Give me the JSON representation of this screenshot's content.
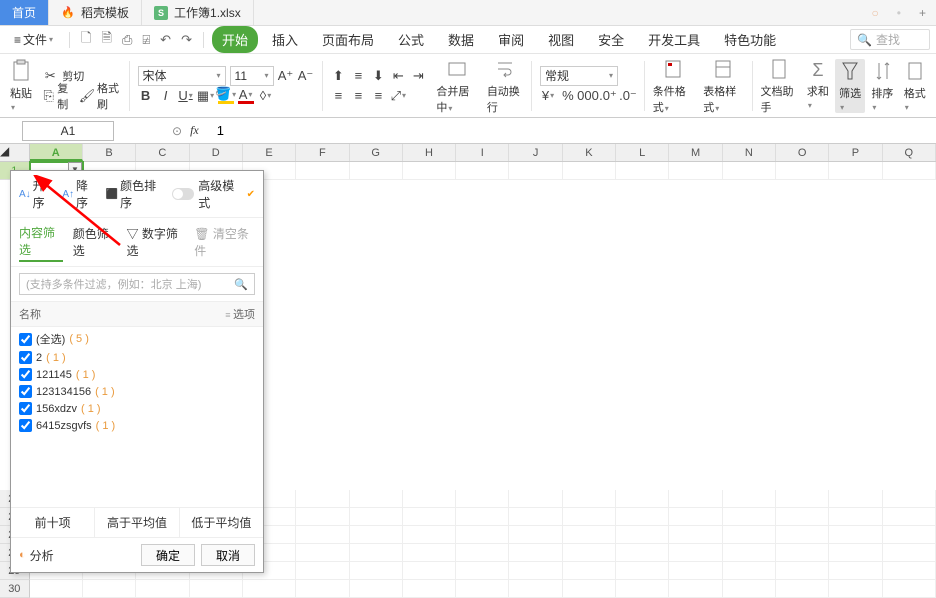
{
  "tabs": {
    "home": "首页",
    "template": "稻壳模板",
    "workbook": "工作簿1.xlsx"
  },
  "menu": {
    "file": "文件",
    "start": "开始",
    "insert": "插入",
    "page_layout": "页面布局",
    "formula": "公式",
    "data": "数据",
    "review": "审阅",
    "view": "视图",
    "security": "安全",
    "dev": "开发工具",
    "features": "特色功能",
    "search": "查找"
  },
  "ribbon": {
    "paste": "粘贴",
    "cut": "剪切",
    "copy": "复制",
    "format_painter": "格式刷",
    "font_name": "宋体",
    "font_size": "11",
    "merge": "合并居中",
    "wrap": "自动换行",
    "format": "常规",
    "cond_format": "条件格式",
    "table_style": "表格样式",
    "doc_helper": "文档助手",
    "sum": "求和",
    "filter": "筛选",
    "sort": "排序",
    "style": "格式"
  },
  "name_box": "A1",
  "formula_value": "1",
  "columns": [
    "A",
    "B",
    "C",
    "D",
    "E",
    "F",
    "G",
    "H",
    "I",
    "J",
    "K",
    "L",
    "M",
    "N",
    "O",
    "P",
    "Q"
  ],
  "rows_visible": [
    "1"
  ],
  "rows_visible_bottom": [
    "25",
    "26",
    "27",
    "28",
    "29",
    "30"
  ],
  "filter_panel": {
    "asc": "升序",
    "desc": "降序",
    "color_sort": "颜色排序",
    "advanced": "高级模式",
    "content_filter": "内容筛选",
    "color_filter": "颜色筛选",
    "number_filter": "数字筛选",
    "clear_filter": "清空条件",
    "search_placeholder": "(支持多条件过滤，例如：北京 上海)",
    "name_header": "名称",
    "options_header": "选项",
    "items": [
      {
        "label": "(全选)",
        "count": "( 5 )"
      },
      {
        "label": "2",
        "count": "( 1 )"
      },
      {
        "label": "121145",
        "count": "( 1 )"
      },
      {
        "label": "123134156",
        "count": "( 1 )"
      },
      {
        "label": "156xdzv",
        "count": "( 1 )"
      },
      {
        "label": "6415zsgvfs",
        "count": "( 1 )"
      }
    ],
    "top10": "前十项",
    "above_avg": "高于平均值",
    "below_avg": "低于平均值",
    "analyze": "分析",
    "ok": "确定",
    "cancel": "取消"
  }
}
